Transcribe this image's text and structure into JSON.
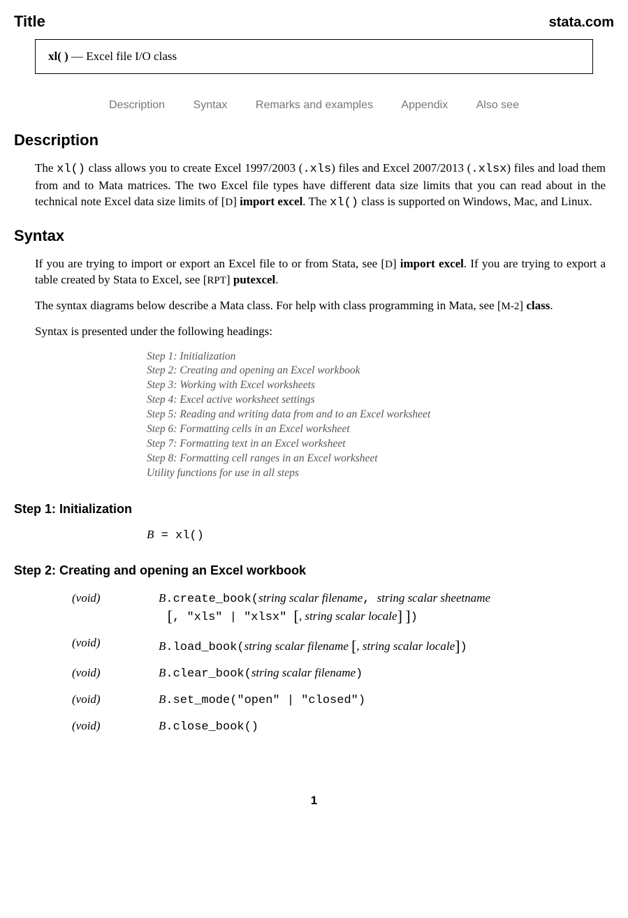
{
  "header": {
    "title": "Title",
    "site": "stata.com"
  },
  "titlebox": {
    "fn": "xl( )",
    "dash": " — ",
    "desc": "Excel file I/O class"
  },
  "nav": {
    "i1": "Description",
    "i2": "Syntax",
    "i3": "Remarks and examples",
    "i4": "Appendix",
    "i5": "Also see"
  },
  "sec": {
    "description": "Description",
    "syntax": "Syntax",
    "step1": "Step 1: Initialization",
    "step2": "Step 2: Creating and opening an Excel workbook"
  },
  "desc": {
    "p1a": "The ",
    "p1b": "xl()",
    "p1c": " class allows you to create Excel 1997/2003 (",
    "p1d": ".xls",
    "p1e": ") files and Excel 2007/2013 (",
    "p1f": ".xlsx",
    "p1g": ") files and load them from and to Mata matrices. The two Excel file types have different data size limits that you can read about in the technical note Excel data size limits of [",
    "p1h": "D",
    "p1i": "] ",
    "p1j": "import excel",
    "p1k": ". The ",
    "p1l": "xl()",
    "p1m": " class is supported on Windows, Mac, and Linux."
  },
  "syn": {
    "p1a": "If you are trying to import or export an Excel file to or from Stata, see [",
    "p1b": "D",
    "p1c": "] ",
    "p1d": "import excel",
    "p1e": ". If you are trying to export a table created by Stata to Excel, see [",
    "p1f": "RPT",
    "p1g": "] ",
    "p1h": "putexcel",
    "p1i": ".",
    "p2a": "The syntax diagrams below describe a Mata class. For help with class programming in Mata, see [",
    "p2b": "M-2",
    "p2c": "] ",
    "p2d": "class",
    "p2e": ".",
    "p3": "Syntax is presented under the following headings:"
  },
  "steps": {
    "s1": "Step 1: Initialization",
    "s2": "Step 2: Creating and opening an Excel workbook",
    "s3": "Step 3: Working with Excel worksheets",
    "s4": "Step 4: Excel active worksheet settings",
    "s5": "Step 5: Reading and writing data from and to an Excel worksheet",
    "s6": "Step 6: Formatting cells in an Excel worksheet",
    "s7": "Step 7: Formatting text in an Excel worksheet",
    "s8": "Step 8: Formatting cell ranges in an Excel worksheet",
    "s9": "Utility functions for use in all steps"
  },
  "init": {
    "B": "B",
    "eq": " = ",
    "xl": "xl()"
  },
  "table": {
    "void": "(void)",
    "B": "B",
    "r1": {
      "fn": ".create_book(",
      "a1": "string scalar filename",
      "c1": ", ",
      "a2": "string scalar sheetname",
      "opt1": ", \"xls\"",
      "pipe": "|",
      "opt2": "\"xlsx\" ",
      "a3": ", string scalar locale",
      "close": ")"
    },
    "r2": {
      "fn": ".load_book(",
      "a1": "string scalar filename ",
      "a2": ", string scalar locale",
      "close": ")"
    },
    "r3": {
      "fn": ".clear_book(",
      "a1": "string scalar filename",
      "close": ")"
    },
    "r4": {
      "fn": ".set_mode(\"open\"",
      "pipe": "|",
      "rest": "\"closed\")"
    },
    "r5": {
      "fn": ".close_book()"
    }
  },
  "page": "1"
}
